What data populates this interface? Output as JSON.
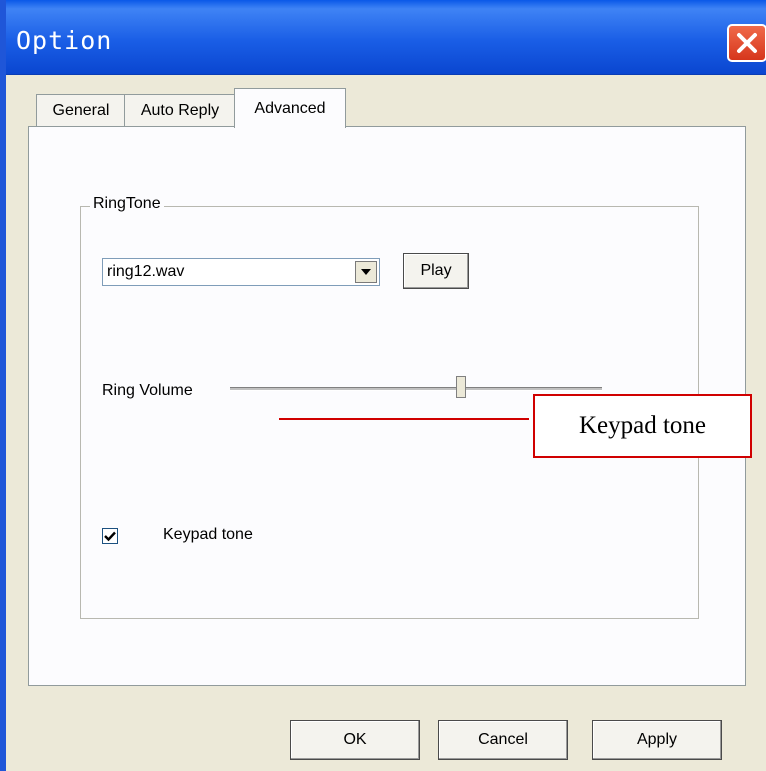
{
  "window": {
    "title": "Option"
  },
  "tabs": [
    {
      "label": "General",
      "active": false
    },
    {
      "label": "Auto Reply",
      "active": false
    },
    {
      "label": "Advanced",
      "active": true
    }
  ],
  "ringtone": {
    "group_label": "RingTone",
    "selected_file": "ring12.wav",
    "play_label": "Play",
    "volume_label": "Ring Volume",
    "volume_level": 0.62,
    "keypad_tone_label": "Keypad tone",
    "keypad_tone_checked": true
  },
  "annotation": {
    "text": "Keypad tone",
    "color": "#d00000"
  },
  "buttons": {
    "ok": "OK",
    "cancel": "Cancel",
    "apply": "Apply"
  },
  "icons": {
    "close": "close-icon",
    "dropdown": "chevron-down-icon",
    "check": "check-icon"
  },
  "colors": {
    "titlebar": "#0a58e8",
    "close": "#d6361c",
    "dialog_bg": "#ece9d8"
  }
}
